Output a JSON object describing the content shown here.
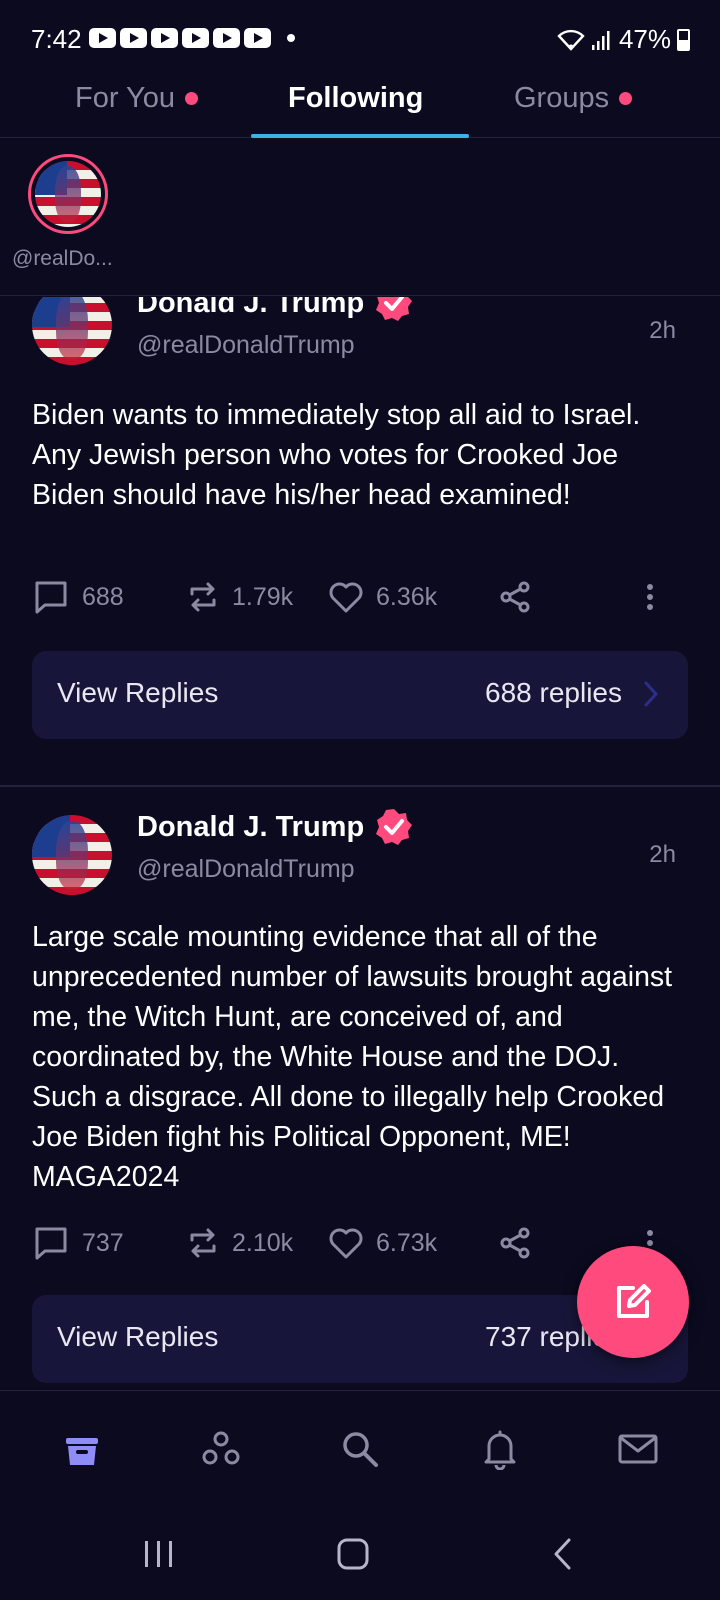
{
  "status_bar": {
    "time": "7:42",
    "battery": "47%"
  },
  "tabs": [
    {
      "label": "For You",
      "has_dot": true
    },
    {
      "label": "Following",
      "active": true
    },
    {
      "label": "Groups",
      "has_dot": true
    }
  ],
  "stories": [
    {
      "label": "@realDo..."
    }
  ],
  "posts": [
    {
      "author": "Donald J. Trump",
      "handle": "@realDonaldTrump",
      "time": "2h",
      "text": "Biden wants to immediately stop all aid to Israel. Any Jewish person who votes for Crooked Joe Biden should have his/her head examined!",
      "replies": "688",
      "reposts": "1.79k",
      "likes": "6.36k",
      "view_replies_label": "View Replies",
      "replies_count_label": "688 replies"
    },
    {
      "author": "Donald J. Trump",
      "handle": "@realDonaldTrump",
      "time": "2h",
      "text": "Large scale mounting evidence that all of the unprecedented number of lawsuits brought against me, the Witch Hunt, are conceived of, and coordinated by, the White House and the DOJ. Such a disgrace. All done to illegally help Crooked Joe Biden fight his Political Opponent, ME! MAGA2024",
      "replies": "737",
      "reposts": "2.10k",
      "likes": "6.73k",
      "view_replies_label": "View Replies",
      "replies_count_label": "737 replies"
    }
  ],
  "bottom_nav": [
    "home-icon",
    "groups-icon",
    "search-icon",
    "notifications-icon",
    "messages-icon"
  ],
  "colors": {
    "background": "#0b0a1f",
    "accent": "#ff4a7d",
    "tab_underline": "#3bb4e5",
    "nav_active": "#8e8cf5",
    "card": "#17163a"
  }
}
